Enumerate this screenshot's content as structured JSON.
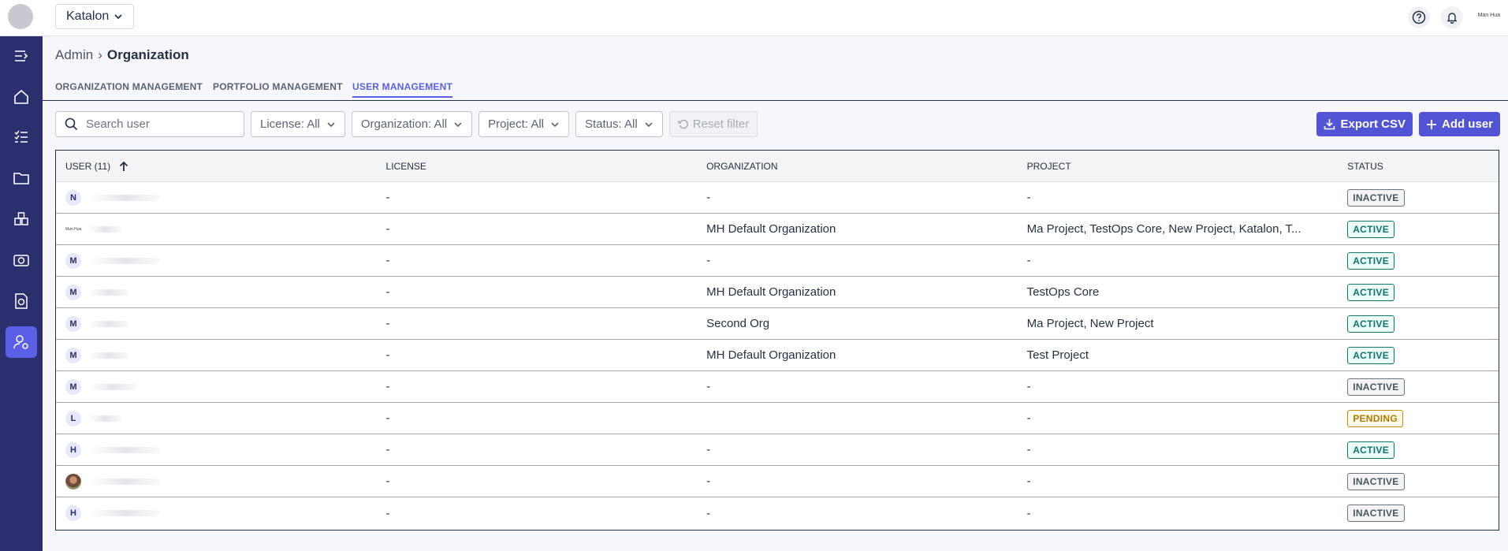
{
  "topbar": {
    "org_selector": "Katalon",
    "help_icon": "help-circle-icon",
    "notification_icon": "bell-icon",
    "user_name": "Man Hua"
  },
  "sidebar": {
    "items": [
      {
        "icon": "collapse-menu-icon"
      },
      {
        "icon": "home-icon"
      },
      {
        "icon": "checklist-icon"
      },
      {
        "icon": "folder-icon"
      },
      {
        "icon": "boxes-icon"
      },
      {
        "icon": "camera-icon"
      },
      {
        "icon": "report-icon"
      },
      {
        "icon": "user-admin-icon",
        "active": true
      }
    ],
    "accent": "#2b2f6e"
  },
  "breadcrumb": {
    "parent": "Admin",
    "separator": "›",
    "current": "Organization"
  },
  "tabs": [
    {
      "label": "ORGANIZATION MANAGEMENT",
      "active": false
    },
    {
      "label": "PORTFOLIO MANAGEMENT",
      "active": false
    },
    {
      "label": "USER MANAGEMENT",
      "active": true
    }
  ],
  "filters": {
    "search_placeholder": "Search user",
    "license": "License: All",
    "organization": "Organization: All",
    "project": "Project: All",
    "status": "Status: All",
    "reset": "Reset filter"
  },
  "actions": {
    "export": "Export CSV",
    "add_user": "Add user"
  },
  "table": {
    "headers": {
      "user": "USER (11)",
      "license": "LICENSE",
      "organization": "ORGANIZATION",
      "project": "PROJECT",
      "status": "STATUS"
    },
    "rows": [
      {
        "initial": "N",
        "license": "-",
        "organization": "-",
        "project": "-",
        "status": "INACTIVE",
        "status_type": "inactive"
      },
      {
        "initial": "Man Hua",
        "license": "-",
        "organization": "MH Default Organization",
        "project": "Ma        Project, TestOps Core, New Project, Katalon, T...",
        "status": "ACTIVE",
        "status_type": "active"
      },
      {
        "initial": "M",
        "license": "-",
        "organization": "-",
        "project": "-",
        "status": "ACTIVE",
        "status_type": "active"
      },
      {
        "initial": "M",
        "license": "-",
        "organization": "MH Default Organization",
        "project": "TestOps Core",
        "status": "ACTIVE",
        "status_type": "active"
      },
      {
        "initial": "M",
        "license": "-",
        "organization": "Second Org",
        "project": "Ma        Project, New Project",
        "status": "ACTIVE",
        "status_type": "active"
      },
      {
        "initial": "M",
        "license": "-",
        "organization": "MH Default Organization",
        "project": "Test Project",
        "status": "ACTIVE",
        "status_type": "active"
      },
      {
        "initial": "M",
        "license": "-",
        "organization": "-",
        "project": "-",
        "status": "INACTIVE",
        "status_type": "inactive"
      },
      {
        "initial": "L",
        "license": "-",
        "organization": "",
        "project": "-",
        "status": "PENDING",
        "status_type": "pending"
      },
      {
        "initial": "H",
        "license": "-",
        "organization": "-",
        "project": "-",
        "status": "ACTIVE",
        "status_type": "active"
      },
      {
        "initial": "",
        "license": "-",
        "organization": "-",
        "project": "-",
        "status": "INACTIVE",
        "status_type": "inactive"
      },
      {
        "initial": "H",
        "license": "-",
        "organization": "-",
        "project": "-",
        "status": "INACTIVE",
        "status_type": "inactive"
      }
    ]
  }
}
